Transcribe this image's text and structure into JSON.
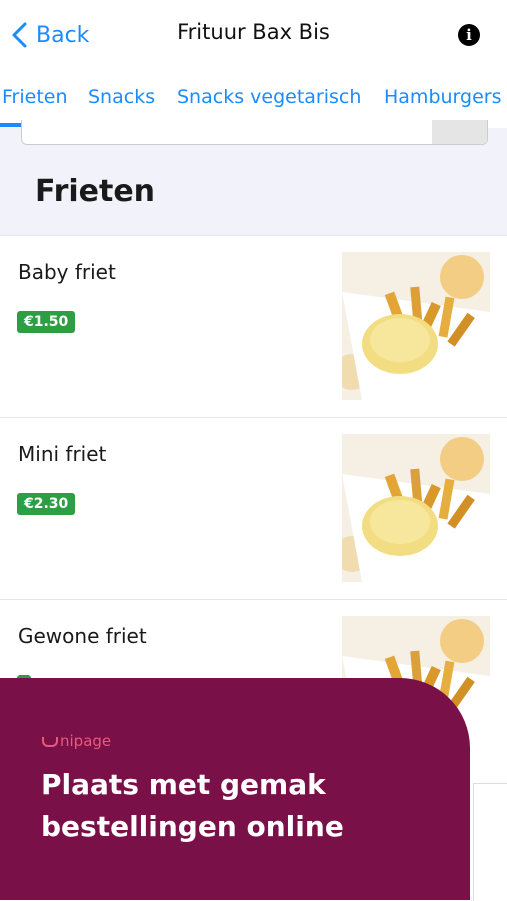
{
  "header": {
    "back_label": "Back",
    "title": "Frituur Bax Bis"
  },
  "tabs": [
    {
      "label": "Frieten"
    },
    {
      "label": "Snacks"
    },
    {
      "label": "Snacks vegetarisch"
    },
    {
      "label": "Hamburgers"
    }
  ],
  "section": {
    "title": "Frieten"
  },
  "items": [
    {
      "name": "Baby friet",
      "price": "€1.50"
    },
    {
      "name": "Mini friet",
      "price": "€2.30"
    },
    {
      "name": "Gewone friet",
      "price": ""
    }
  ],
  "promo": {
    "brand": "nipage",
    "text": "Plaats met gemak bestellingen online"
  },
  "colors": {
    "accent": "#1a8cff",
    "price_badge": "#2e9e44",
    "promo_bg": "#7a1048",
    "section_bg": "#f2f2fb"
  }
}
